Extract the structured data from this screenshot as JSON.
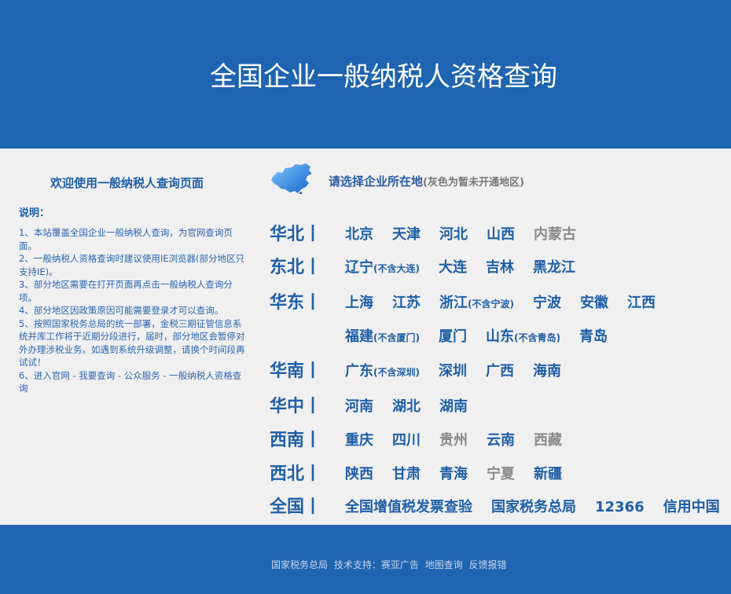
{
  "header": {
    "title": "全国企业一般纳税人资格查询"
  },
  "left": {
    "welcome": "欢迎使用一般纳税人查询页面",
    "notes_title": "说明：",
    "notes": [
      "1、本站覆盖全国企业一般纳税人查询，为官网查询页面。",
      "2、一般纳税人资格查询时建议使用IE浏览器(部分地区只支持IE)。",
      "3、部分地区需要在打开页面再点击一般纳税人查询分项。",
      "4、部分地区因政策原因可能需要登录才可以查询。",
      "5、按照国家税务总局的统一部署，金税三期征管信息系统并库工作将于近期分段进行，届时，部分地区会暂停对外办理涉税业务。如遇到系统升级调整，请换个时间段再试试！",
      "6、进入官网 - 我要查询 - 公众服务 - 一般纳税人资格查询"
    ]
  },
  "right": {
    "choose_main": "请选择企业所在地",
    "choose_note": "(灰色为暂未开通地区)",
    "map_icon": "china-map-icon",
    "regions": [
      {
        "name": "华北丨",
        "cities": [
          {
            "label": "北京",
            "note": "",
            "enabled": true
          },
          {
            "label": "天津",
            "note": "",
            "enabled": true
          },
          {
            "label": "河北",
            "note": "",
            "enabled": true
          },
          {
            "label": "山西",
            "note": "",
            "enabled": true
          },
          {
            "label": "内蒙古",
            "note": "",
            "enabled": false
          }
        ]
      },
      {
        "name": "东北丨",
        "cities": [
          {
            "label": "辽宁",
            "note": "(不含大连)",
            "enabled": true
          },
          {
            "label": "大连",
            "note": "",
            "enabled": true
          },
          {
            "label": "吉林",
            "note": "",
            "enabled": true
          },
          {
            "label": "黑龙江",
            "note": "",
            "enabled": true
          }
        ]
      },
      {
        "name": "华东丨",
        "cities": [
          {
            "label": "上海",
            "note": "",
            "enabled": true
          },
          {
            "label": "江苏",
            "note": "",
            "enabled": true
          },
          {
            "label": "浙江",
            "note": "(不含宁波)",
            "enabled": true
          },
          {
            "label": "宁波",
            "note": "",
            "enabled": true
          },
          {
            "label": "安徽",
            "note": "",
            "enabled": true
          },
          {
            "label": "江西",
            "note": "",
            "enabled": true
          }
        ]
      },
      {
        "name": "",
        "cities": [
          {
            "label": "福建",
            "note": "(不含厦门)",
            "enabled": true
          },
          {
            "label": "厦门",
            "note": "",
            "enabled": true
          },
          {
            "label": "山东",
            "note": "(不含青岛)",
            "enabled": true
          },
          {
            "label": "青岛",
            "note": "",
            "enabled": true
          }
        ]
      },
      {
        "name": "华南丨",
        "cities": [
          {
            "label": "广东",
            "note": "(不含深圳)",
            "enabled": true
          },
          {
            "label": "深圳",
            "note": "",
            "enabled": true
          },
          {
            "label": "广西",
            "note": "",
            "enabled": true
          },
          {
            "label": "海南",
            "note": "",
            "enabled": true
          }
        ]
      },
      {
        "name": "华中丨",
        "cities": [
          {
            "label": "河南",
            "note": "",
            "enabled": true
          },
          {
            "label": "湖北",
            "note": "",
            "enabled": true
          },
          {
            "label": "湖南",
            "note": "",
            "enabled": true
          }
        ]
      },
      {
        "name": "西南丨",
        "cities": [
          {
            "label": "重庆",
            "note": "",
            "enabled": true
          },
          {
            "label": "四川",
            "note": "",
            "enabled": true
          },
          {
            "label": "贵州",
            "note": "",
            "enabled": false
          },
          {
            "label": "云南",
            "note": "",
            "enabled": true
          },
          {
            "label": "西藏",
            "note": "",
            "enabled": false
          }
        ]
      },
      {
        "name": "西北丨",
        "cities": [
          {
            "label": "陕西",
            "note": "",
            "enabled": true
          },
          {
            "label": "甘肃",
            "note": "",
            "enabled": true
          },
          {
            "label": "青海",
            "note": "",
            "enabled": true
          },
          {
            "label": "宁夏",
            "note": "",
            "enabled": false
          },
          {
            "label": "新疆",
            "note": "",
            "enabled": true
          }
        ]
      },
      {
        "name": "全国丨",
        "cities": [
          {
            "label": "全国增值税发票查验",
            "note": "",
            "enabled": true
          },
          {
            "label": "国家税务总局",
            "note": "",
            "enabled": true
          },
          {
            "label": "12366",
            "note": "",
            "enabled": true
          },
          {
            "label": "信用中国",
            "note": "",
            "enabled": true
          }
        ]
      }
    ]
  },
  "footer": {
    "links": [
      "国家税务总局",
      "技术支持：赛亚广告",
      "地图查询",
      "反馈报错"
    ]
  },
  "colors": {
    "brand_blue": "#1f64b0",
    "link_blue": "#1f5fa6",
    "disabled_gray": "#8a8a8a",
    "background": "#f0f0f0"
  }
}
